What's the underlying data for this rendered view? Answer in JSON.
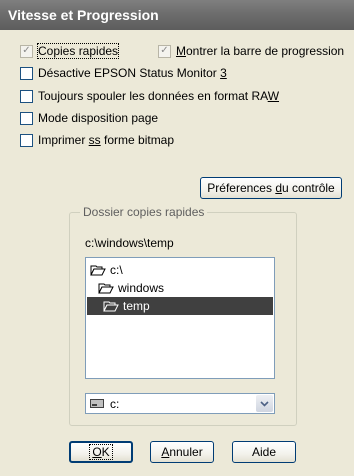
{
  "window": {
    "title": "Vitesse et Progression"
  },
  "options": {
    "copies_rapides": {
      "label": "Copies rapides",
      "checked": true
    },
    "montrer_barre": {
      "label_prefix": "",
      "label_u": "M",
      "label_rest": "ontrer la barre de progression",
      "checked": true
    },
    "desactive_epson": {
      "label_prefix": "Désactive EPSON Status Monitor ",
      "label_u": "3",
      "label_rest": "",
      "checked": false
    },
    "toujours_spouler": {
      "label_prefix": "Toujours spouler les données en format RA",
      "label_u": "W",
      "label_rest": "",
      "checked": false
    },
    "mode_disposition": {
      "label": "Mode disposition page",
      "checked": false
    },
    "imprimer_bitmap": {
      "label_prefix": "Imprimer ",
      "label_u": "ss",
      "label_rest": " forme bitmap",
      "checked": false
    }
  },
  "preferences_button": {
    "label_prefix": "Préferences ",
    "label_u": "d",
    "label_rest": "u contrôle"
  },
  "dossier_group": {
    "title": "Dossier copies rapides",
    "path": "c:\\windows\\temp",
    "tree": [
      {
        "label": "c:\\",
        "selected": false,
        "icon": "open-folder-icon"
      },
      {
        "label": "windows",
        "selected": false,
        "icon": "open-folder-icon"
      },
      {
        "label": "temp",
        "selected": true,
        "icon": "open-folder-icon"
      }
    ],
    "drive": {
      "value": "c:",
      "icon": "drive-icon"
    }
  },
  "buttons": {
    "ok": {
      "label_u": "O",
      "label_rest": "K"
    },
    "annuler": {
      "label_u": "A",
      "label_rest": "nnuler"
    },
    "aide": {
      "label_prefix": "Aide"
    }
  },
  "colors": {
    "selection": "#404040",
    "dialog_bg": "#ece9d8",
    "titlebar": "#6f6f6f"
  }
}
